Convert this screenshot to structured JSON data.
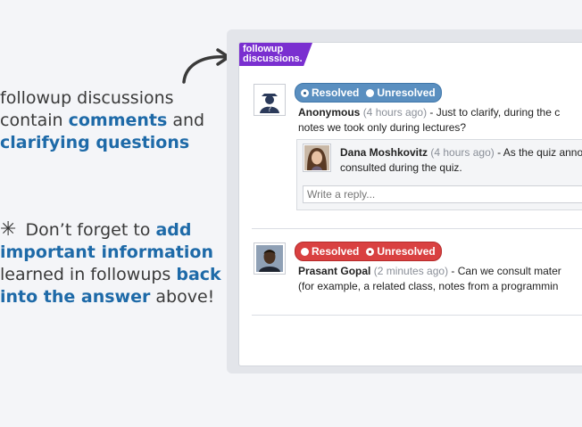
{
  "annotations": {
    "intro": {
      "t1": "followup discussions",
      "t2": "contain ",
      "t3": "comments",
      "t4": " and",
      "t5": "clarifying questions"
    },
    "tip": {
      "star": "✳",
      "t1": " Don’t forget to ",
      "t2": "add important information",
      "t3": " learned in followups ",
      "t4": "back into the answer",
      "t5": " above!"
    }
  },
  "panel": {
    "tag_line1": "followup",
    "tag_line2": "discussions.",
    "threads": [
      {
        "status_selected": "Resolved",
        "resolved_label": "Resolved",
        "unresolved_label": "Unresolved",
        "author": "Anonymous",
        "time": "(4 hours ago)",
        "text_line1": " - Just to clarify, during the c",
        "text_line2": "notes we took only during lectures?",
        "reply": {
          "author": "Dana Moshkovitz",
          "time": "(4 hours ago)",
          "text_line1": " - As the quiz anno",
          "text_line2": "consulted during the quiz."
        },
        "reply_placeholder": "Write a reply..."
      },
      {
        "status_selected": "Unresolved",
        "resolved_label": "Resolved",
        "unresolved_label": "Unresolved",
        "author": "Prasant Gopal",
        "time": "(2 minutes ago)",
        "text_line1": " - Can we consult mater",
        "text_line2": "(for example, a related class, notes from a programmin"
      }
    ]
  },
  "colors": {
    "accent_blue": "#1e6aa8",
    "tag_purple": "#7a2fd0",
    "resolved_blue": "#5a8fc0",
    "unresolved_red": "#d94141"
  }
}
